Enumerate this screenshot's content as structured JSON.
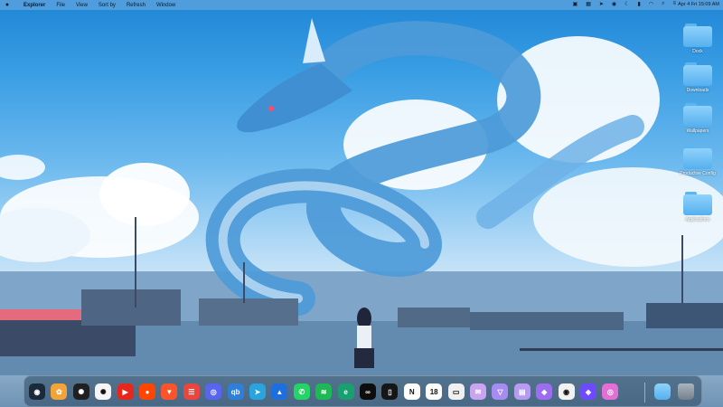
{
  "menubar": {
    "apple_icon": "apple-logo-icon",
    "app_name": "Explorer",
    "menus": [
      "File",
      "View",
      "Sort by",
      "Refresh",
      "Window"
    ],
    "status_icons": [
      "screen-icon",
      "grid-icon",
      "send-icon",
      "location-icon",
      "moon-icon",
      "battery-icon",
      "wifi-icon",
      "search-icon",
      "control-center-icon"
    ],
    "clock": "Apr 4 Fri 15:09 AM"
  },
  "desktop": {
    "folders": [
      {
        "label": "Dock"
      },
      {
        "label": "Downloads"
      },
      {
        "label": "Wallpapers"
      },
      {
        "label": "Productive Config"
      },
      {
        "label": "Applications"
      }
    ]
  },
  "dock": {
    "apps": [
      {
        "name": "dragon-app",
        "glyph": "◉",
        "color": "#1b2a3a"
      },
      {
        "name": "photos",
        "glyph": "✿",
        "color": "#f2a33a"
      },
      {
        "name": "chatgpt-alt",
        "glyph": "✺",
        "color": "#202020"
      },
      {
        "name": "chatgpt",
        "glyph": "✺",
        "color": "#f5f5f5"
      },
      {
        "name": "youtube",
        "glyph": "▶",
        "color": "#e8271c"
      },
      {
        "name": "reddit",
        "glyph": "●",
        "color": "#ff4500"
      },
      {
        "name": "brave",
        "glyph": "▼",
        "color": "#fb542b"
      },
      {
        "name": "tasks",
        "glyph": "☰",
        "color": "#e8463f"
      },
      {
        "name": "discord",
        "glyph": "◎",
        "color": "#5865f2"
      },
      {
        "name": "qbittorrent",
        "glyph": "qb",
        "color": "#2f7ed8"
      },
      {
        "name": "telegram",
        "glyph": "➤",
        "color": "#2aa3de"
      },
      {
        "name": "navigation",
        "glyph": "▲",
        "color": "#1d6fe0"
      },
      {
        "name": "whatsapp",
        "glyph": "✆",
        "color": "#25d366"
      },
      {
        "name": "spotify",
        "glyph": "≋",
        "color": "#1db954"
      },
      {
        "name": "edge",
        "glyph": "e",
        "color": "#1aa070"
      },
      {
        "name": "linear",
        "glyph": "∞",
        "color": "#0d0d0d"
      },
      {
        "name": "notch",
        "glyph": "▯",
        "color": "#161616"
      },
      {
        "name": "notion",
        "glyph": "N",
        "color": "#ffffff"
      },
      {
        "name": "calendar",
        "glyph": "18",
        "color": "#ffffff"
      },
      {
        "name": "finder-window",
        "glyph": "▭",
        "color": "#f0f0f0"
      },
      {
        "name": "mail",
        "glyph": "✉",
        "color": "#c9a4f0"
      },
      {
        "name": "vector",
        "glyph": "▽",
        "color": "#a68cf0"
      },
      {
        "name": "files",
        "glyph": "▤",
        "color": "#b69af3"
      },
      {
        "name": "shortcuts",
        "glyph": "◆",
        "color": "#9b6ef0"
      },
      {
        "name": "chrome",
        "glyph": "◉",
        "color": "#f2f2f2"
      },
      {
        "name": "proton-vpn",
        "glyph": "◈",
        "color": "#6d4aff"
      },
      {
        "name": "arc",
        "glyph": "◎",
        "color": "#e36fd6"
      },
      {
        "name": "downloads-folder",
        "glyph": "",
        "color": "#5ab6f2"
      },
      {
        "name": "trash",
        "glyph": "",
        "color": "#8f9aa5"
      }
    ]
  }
}
